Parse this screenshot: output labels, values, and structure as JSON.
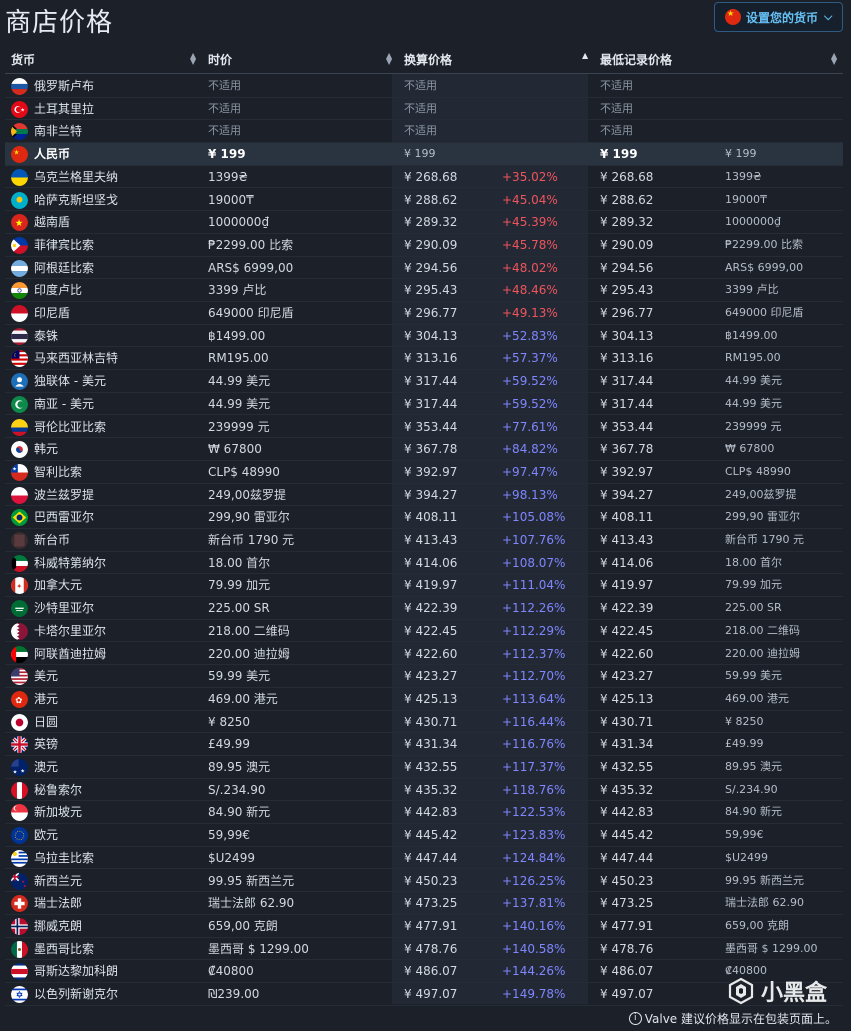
{
  "page_title": "商店价格",
  "currency_button": {
    "label": "设置您的货币",
    "flag_icon": "china-flag-icon",
    "chevron": "chevron-down-icon"
  },
  "headers": {
    "currency": "货币",
    "price": "时价",
    "converted": "换算价格",
    "lowest": "最低记录价格"
  },
  "rows": [
    {
      "flag": "russia",
      "name": "俄罗斯卢布",
      "price": "不适用",
      "conv": "不适用",
      "pct": "",
      "low": "不适用",
      "orig": "",
      "na": true
    },
    {
      "flag": "turkey",
      "name": "土耳其里拉",
      "price": "不适用",
      "conv": "不适用",
      "pct": "",
      "low": "不适用",
      "orig": "",
      "na": true
    },
    {
      "flag": "south-africa",
      "name": "南非兰特",
      "price": "不适用",
      "conv": "不适用",
      "pct": "",
      "low": "不适用",
      "orig": "",
      "na": true
    },
    {
      "flag": "china",
      "name": "人民币",
      "price": "¥ 199",
      "conv": "¥ 199",
      "pct": "",
      "low": "¥ 199",
      "orig": "¥ 199",
      "highlight": true
    },
    {
      "flag": "ukraine",
      "name": "乌克兰格里夫纳",
      "price": "1399₴",
      "conv": "¥ 268.68",
      "pct": "+35.02%",
      "low": "¥ 268.68",
      "orig": "1399₴"
    },
    {
      "flag": "kazakhstan",
      "name": "哈萨克斯坦坚戈",
      "price": "19000₸",
      "conv": "¥ 288.62",
      "pct": "+45.04%",
      "low": "¥ 288.62",
      "orig": "19000₸"
    },
    {
      "flag": "vietnam",
      "name": "越南盾",
      "price": "1000000₫",
      "conv": "¥ 289.32",
      "pct": "+45.39%",
      "low": "¥ 289.32",
      "orig": "1000000₫"
    },
    {
      "flag": "philippines",
      "name": "菲律宾比索",
      "price": "₱2299.00 比索",
      "conv": "¥ 290.09",
      "pct": "+45.78%",
      "low": "¥ 290.09",
      "orig": "₱2299.00 比索"
    },
    {
      "flag": "argentina",
      "name": "阿根廷比索",
      "price": "ARS$ 6999,00",
      "conv": "¥ 294.56",
      "pct": "+48.02%",
      "low": "¥ 294.56",
      "orig": "ARS$ 6999,00"
    },
    {
      "flag": "india",
      "name": "印度卢比",
      "price": "3399 卢比",
      "conv": "¥ 295.43",
      "pct": "+48.46%",
      "low": "¥ 295.43",
      "orig": "3399 卢比"
    },
    {
      "flag": "indonesia",
      "name": "印尼盾",
      "price": "649000 印尼盾",
      "conv": "¥ 296.77",
      "pct": "+49.13%",
      "low": "¥ 296.77",
      "orig": "649000 印尼盾"
    },
    {
      "flag": "thailand",
      "name": "泰铢",
      "price": "฿1499.00",
      "conv": "¥ 304.13",
      "pct": "+52.83%",
      "low": "¥ 304.13",
      "orig": "฿1499.00"
    },
    {
      "flag": "malaysia",
      "name": "马来西亚林吉特",
      "price": "RM195.00",
      "conv": "¥ 313.16",
      "pct": "+57.37%",
      "low": "¥ 313.16",
      "orig": "RM195.00"
    },
    {
      "flag": "cis",
      "name": "独联体 - 美元",
      "price": "44.99 美元",
      "conv": "¥ 317.44",
      "pct": "+59.52%",
      "low": "¥ 317.44",
      "orig": "44.99 美元"
    },
    {
      "flag": "south-asia",
      "name": "南亚 - 美元",
      "price": "44.99 美元",
      "conv": "¥ 317.44",
      "pct": "+59.52%",
      "low": "¥ 317.44",
      "orig": "44.99 美元"
    },
    {
      "flag": "colombia",
      "name": "哥伦比亚比索",
      "price": "239999 元",
      "conv": "¥ 353.44",
      "pct": "+77.61%",
      "low": "¥ 353.44",
      "orig": "239999 元"
    },
    {
      "flag": "korea",
      "name": "韩元",
      "price": "₩ 67800",
      "conv": "¥ 367.78",
      "pct": "+84.82%",
      "low": "¥ 367.78",
      "orig": "₩ 67800"
    },
    {
      "flag": "chile",
      "name": "智利比索",
      "price": "CLP$ 48990",
      "conv": "¥ 392.97",
      "pct": "+97.47%",
      "low": "¥ 392.97",
      "orig": "CLP$ 48990"
    },
    {
      "flag": "poland",
      "name": "波兰兹罗提",
      "price": "249,00兹罗提",
      "conv": "¥ 394.27",
      "pct": "+98.13%",
      "low": "¥ 394.27",
      "orig": "249,00兹罗提"
    },
    {
      "flag": "brazil",
      "name": "巴西雷亚尔",
      "price": "299,90 雷亚尔",
      "conv": "¥ 408.11",
      "pct": "+105.08%",
      "low": "¥ 408.11",
      "orig": "299,90 雷亚尔"
    },
    {
      "flag": "taiwan",
      "name": "新台币",
      "price": "新台币 1790 元",
      "conv": "¥ 413.43",
      "pct": "+107.76%",
      "low": "¥ 413.43",
      "orig": "新台币 1790 元"
    },
    {
      "flag": "kuwait",
      "name": "科威特第纳尔",
      "price": "18.00 首尔",
      "conv": "¥ 414.06",
      "pct": "+108.07%",
      "low": "¥ 414.06",
      "orig": "18.00 首尔"
    },
    {
      "flag": "canada",
      "name": "加拿大元",
      "price": "79.99 加元",
      "conv": "¥ 419.97",
      "pct": "+111.04%",
      "low": "¥ 419.97",
      "orig": "79.99 加元"
    },
    {
      "flag": "saudi",
      "name": "沙特里亚尔",
      "price": "225.00 SR",
      "conv": "¥ 422.39",
      "pct": "+112.26%",
      "low": "¥ 422.39",
      "orig": "225.00 SR"
    },
    {
      "flag": "qatar",
      "name": "卡塔尔里亚尔",
      "price": "218.00 二维码",
      "conv": "¥ 422.45",
      "pct": "+112.29%",
      "low": "¥ 422.45",
      "orig": "218.00 二维码"
    },
    {
      "flag": "uae",
      "name": "阿联酋迪拉姆",
      "price": "220.00 迪拉姆",
      "conv": "¥ 422.60",
      "pct": "+112.37%",
      "low": "¥ 422.60",
      "orig": "220.00 迪拉姆"
    },
    {
      "flag": "usa",
      "name": "美元",
      "price": "59.99 美元",
      "conv": "¥ 423.27",
      "pct": "+112.70%",
      "low": "¥ 423.27",
      "orig": "59.99 美元"
    },
    {
      "flag": "hongkong",
      "name": "港元",
      "price": "469.00 港元",
      "conv": "¥ 425.13",
      "pct": "+113.64%",
      "low": "¥ 425.13",
      "orig": "469.00 港元"
    },
    {
      "flag": "japan",
      "name": "日圆",
      "price": "¥ 8250",
      "conv": "¥ 430.71",
      "pct": "+116.44%",
      "low": "¥ 430.71",
      "orig": "¥ 8250"
    },
    {
      "flag": "uk",
      "name": "英镑",
      "price": "£49.99",
      "conv": "¥ 431.34",
      "pct": "+116.76%",
      "low": "¥ 431.34",
      "orig": "£49.99"
    },
    {
      "flag": "australia",
      "name": "澳元",
      "price": "89.95 澳元",
      "conv": "¥ 432.55",
      "pct": "+117.37%",
      "low": "¥ 432.55",
      "orig": "89.95 澳元"
    },
    {
      "flag": "peru",
      "name": "秘鲁索尔",
      "price": "S/.234.90",
      "conv": "¥ 435.32",
      "pct": "+118.76%",
      "low": "¥ 435.32",
      "orig": "S/.234.90"
    },
    {
      "flag": "singapore",
      "name": "新加坡元",
      "price": "84.90 新元",
      "conv": "¥ 442.83",
      "pct": "+122.53%",
      "low": "¥ 442.83",
      "orig": "84.90 新元"
    },
    {
      "flag": "eu",
      "name": "欧元",
      "price": "59,99€",
      "conv": "¥ 445.42",
      "pct": "+123.83%",
      "low": "¥ 445.42",
      "orig": "59,99€"
    },
    {
      "flag": "uruguay",
      "name": "乌拉圭比索",
      "price": "$U2499",
      "conv": "¥ 447.44",
      "pct": "+124.84%",
      "low": "¥ 447.44",
      "orig": "$U2499"
    },
    {
      "flag": "newzealand",
      "name": "新西兰元",
      "price": "99.95 新西兰元",
      "conv": "¥ 450.23",
      "pct": "+126.25%",
      "low": "¥ 450.23",
      "orig": "99.95 新西兰元"
    },
    {
      "flag": "switzerland",
      "name": "瑞士法郎",
      "price": "瑞士法郎 62.90",
      "conv": "¥ 473.25",
      "pct": "+137.81%",
      "low": "¥ 473.25",
      "orig": "瑞士法郎 62.90"
    },
    {
      "flag": "norway",
      "name": "挪威克朗",
      "price": "659,00 克朗",
      "conv": "¥ 477.91",
      "pct": "+140.16%",
      "low": "¥ 477.91",
      "orig": "659,00 克朗"
    },
    {
      "flag": "mexico",
      "name": "墨西哥比索",
      "price": "墨西哥 $ 1299.00",
      "conv": "¥ 478.76",
      "pct": "+140.58%",
      "low": "¥ 478.76",
      "orig": "墨西哥 $ 1299.00"
    },
    {
      "flag": "costarica",
      "name": "哥斯达黎加科朗",
      "price": "₡40800",
      "conv": "¥ 486.07",
      "pct": "+144.26%",
      "low": "¥ 486.07",
      "orig": "₡40800"
    },
    {
      "flag": "israel",
      "name": "以色列新谢克尔",
      "price": "₪239.00",
      "conv": "¥ 497.07",
      "pct": "+149.78%",
      "low": "¥ 497.07",
      "orig": ""
    }
  ],
  "footer_note": "Valve 建议价格显示在包装页面上。",
  "watermark": "小黑盒",
  "colors": {
    "pct_red": "#f0545c",
    "pct_blue": "#7f86ff",
    "accent": "#66c0f4",
    "background": "#1b2029"
  }
}
